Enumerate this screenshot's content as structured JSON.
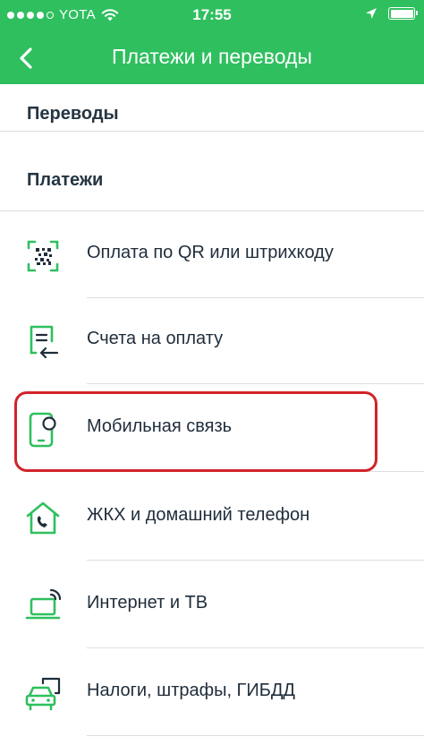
{
  "status_bar": {
    "carrier": "YOTA",
    "time": "17:55",
    "signal_bars_filled": 4,
    "signal_bars_total": 5
  },
  "header": {
    "title": "Платежи и переводы",
    "back_icon": "chevron-left-icon"
  },
  "sections": {
    "transfers": "Переводы",
    "payments": "Платежи"
  },
  "payment_items": [
    {
      "label": "Оплата по QR или штрихкоду",
      "icon": "qr-code-icon"
    },
    {
      "label": "Счета на оплату",
      "icon": "invoice-icon"
    },
    {
      "label": "Мобильная связь",
      "icon": "mobile-phone-icon"
    },
    {
      "label": "ЖКХ и домашний телефон",
      "icon": "house-phone-icon"
    },
    {
      "label": "Интернет и ТВ",
      "icon": "internet-tv-icon"
    },
    {
      "label": "Налоги, штрафы, ГИБДД",
      "icon": "car-icon"
    }
  ],
  "colors": {
    "brand_green": "#2fbf5f",
    "highlight_red": "#d2232a"
  }
}
